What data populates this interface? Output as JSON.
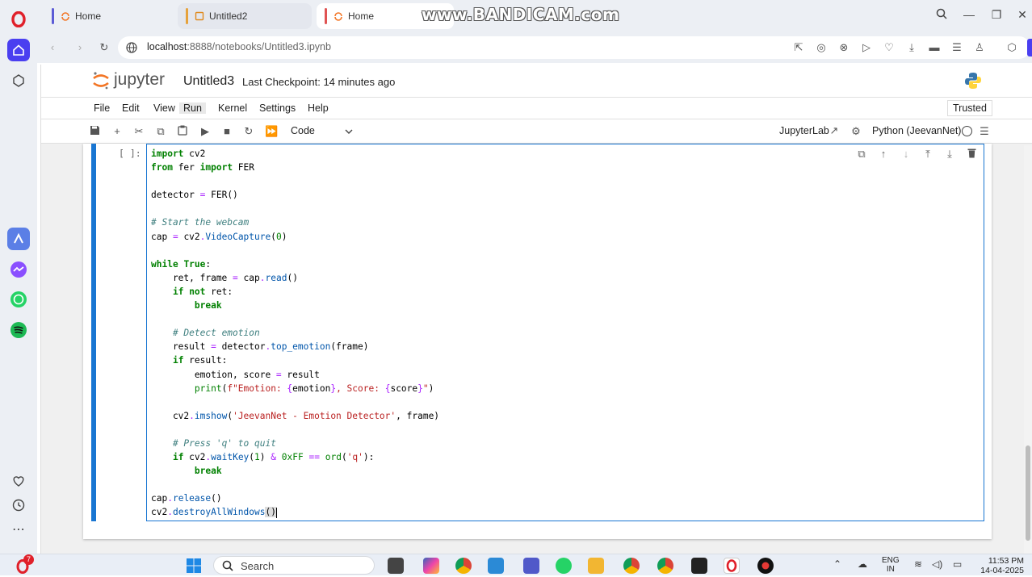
{
  "browser": {
    "tabs": [
      {
        "label": "Home",
        "accent": "#5b5bd6"
      },
      {
        "label": "Untitled2",
        "accent": "#e6a23c"
      },
      {
        "label": "Home",
        "accent": "#e05353"
      }
    ],
    "url_host": "localhost",
    "url_path": ":8888/notebooks/Untitled3.ipynb",
    "watermark": "www.BANDICAM.com"
  },
  "jupyter": {
    "logo_text": "jupyter",
    "notebook_title": "Untitled3",
    "checkpoint": "Last Checkpoint: 14 minutes ago",
    "menu": [
      "File",
      "Edit",
      "View",
      "Run",
      "Kernel",
      "Settings",
      "Help"
    ],
    "trusted": "Trusted",
    "cell_type": "Code",
    "jupyterlab_link": "JupyterLab",
    "kernel_name": "Python (JeevanNet)",
    "cell_prompt": "[ ]:"
  },
  "taskbar": {
    "search": "Search",
    "lang_line1": "ENG",
    "lang_line2": "IN",
    "time": "11:53 PM",
    "date": "14-04-2025",
    "opera_badge": "7"
  }
}
